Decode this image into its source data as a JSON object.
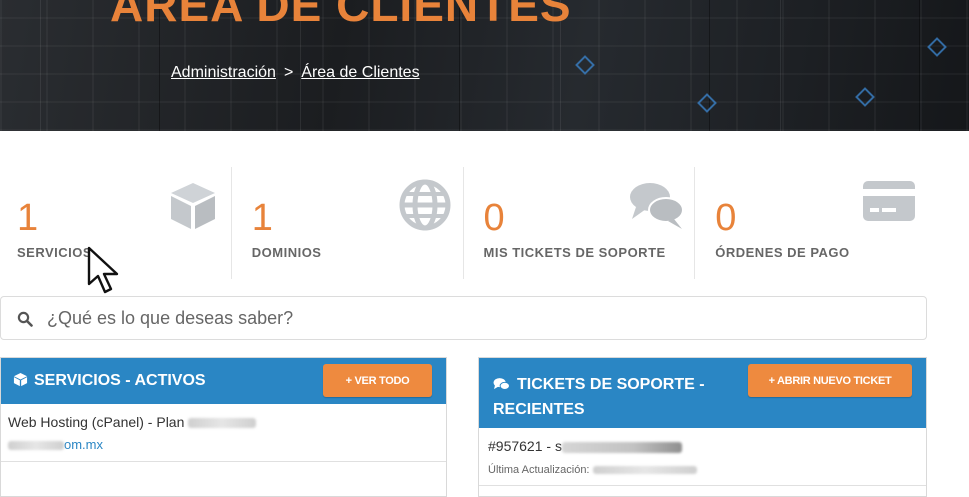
{
  "hero": {
    "title": "ÁREA DE CLIENTES",
    "breadcrumb": {
      "home": "Administración",
      "separator": ">",
      "current": "Área de Clientes"
    }
  },
  "stats": [
    {
      "value": "1",
      "label": "SERVICIOS",
      "icon": "cube-icon"
    },
    {
      "value": "1",
      "label": "DOMINIOS",
      "icon": "globe-icon"
    },
    {
      "value": "0",
      "label": "MIS TICKETS DE SOPORTE",
      "icon": "chat-bubbles-icon"
    },
    {
      "value": "0",
      "label": "ÓRDENES DE PAGO",
      "icon": "credit-card-icon"
    }
  ],
  "search": {
    "placeholder": "¿Qué es lo que deseas saber?",
    "icon": "search-icon"
  },
  "services_panel": {
    "title": "SERVICIOS - ACTIVOS",
    "button": "+ VER TODO",
    "items": [
      {
        "name": "Web Hosting (cPanel) - Plan",
        "domain": "om.mx"
      }
    ]
  },
  "tickets_panel": {
    "title": "TICKETS DE SOPORTE - RECIENTES",
    "button": "+ ABRIR NUEVO TICKET",
    "items": [
      {
        "id": "#957621 - s",
        "updated_label": "Última Actualización:"
      }
    ]
  },
  "colors": {
    "accent": "#e8833a",
    "button": "#ee8a3f",
    "panel_header": "#2a86c4",
    "link": "#2a86c4"
  }
}
